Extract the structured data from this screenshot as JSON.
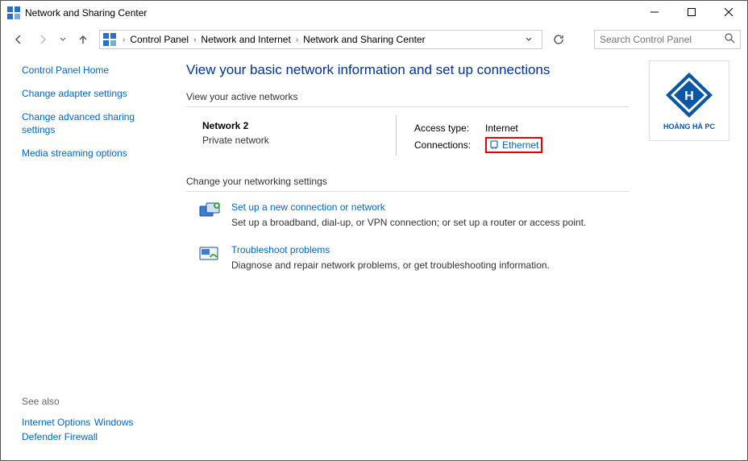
{
  "title": "Network and Sharing Center",
  "breadcrumbs": [
    "Control Panel",
    "Network and Internet",
    "Network and Sharing Center"
  ],
  "search": {
    "placeholder": "Search Control Panel"
  },
  "sidebar": {
    "links": [
      "Control Panel Home",
      "Change adapter settings",
      "Change advanced sharing settings",
      "Media streaming options"
    ],
    "see_also_label": "See also",
    "see_also": [
      "Internet Options",
      "Windows Defender Firewall"
    ]
  },
  "main": {
    "page_title": "View your basic network information and set up connections",
    "active_header": "View your active networks",
    "network": {
      "name": "Network 2",
      "type": "Private network",
      "access_label": "Access type:",
      "access_value": "Internet",
      "conn_label": "Connections:",
      "conn_value": "Ethernet"
    },
    "change_header": "Change your networking settings",
    "items": [
      {
        "title": "Set up a new connection or network",
        "desc": "Set up a broadband, dial-up, or VPN connection; or set up a router or access point."
      },
      {
        "title": "Troubleshoot problems",
        "desc": "Diagnose and repair network problems, or get troubleshooting information."
      }
    ]
  },
  "brand_label": "HOÀNG HÀ PC"
}
